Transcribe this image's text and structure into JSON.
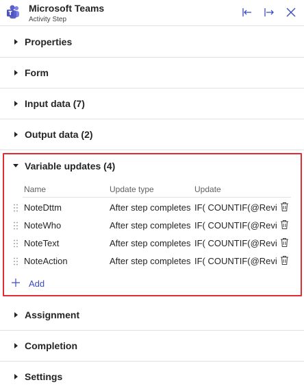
{
  "header": {
    "title": "Microsoft Teams",
    "subtitle": "Activity Step",
    "icon": "teams-icon",
    "buttons": [
      "collapse-left-icon",
      "expand-right-icon",
      "close-icon"
    ]
  },
  "sections_top": [
    {
      "label": "Properties"
    },
    {
      "label": "Form"
    },
    {
      "label": "Input data (7)"
    },
    {
      "label": "Output data (2)"
    }
  ],
  "variable_updates": {
    "label": "Variable updates (4)",
    "columns": [
      "Name",
      "Update type",
      "Update"
    ],
    "rows": [
      {
        "name": "NoteDttm",
        "type": "After step completes",
        "update": "IF( COUNTIF(@Revi..."
      },
      {
        "name": "NoteWho",
        "type": "After step completes",
        "update": "IF( COUNTIF(@Revi..."
      },
      {
        "name": "NoteText",
        "type": "After step completes",
        "update": "IF( COUNTIF(@Revi..."
      },
      {
        "name": "NoteAction",
        "type": "After step completes",
        "update": "IF( COUNTIF(@Revi..."
      }
    ],
    "add_label": "Add"
  },
  "sections_bottom": [
    {
      "label": "Assignment"
    },
    {
      "label": "Completion"
    },
    {
      "label": "Settings"
    }
  ],
  "colors": {
    "highlight": "#e02b35",
    "accent": "#3b4bc0",
    "teams": "#5b5fc7"
  }
}
